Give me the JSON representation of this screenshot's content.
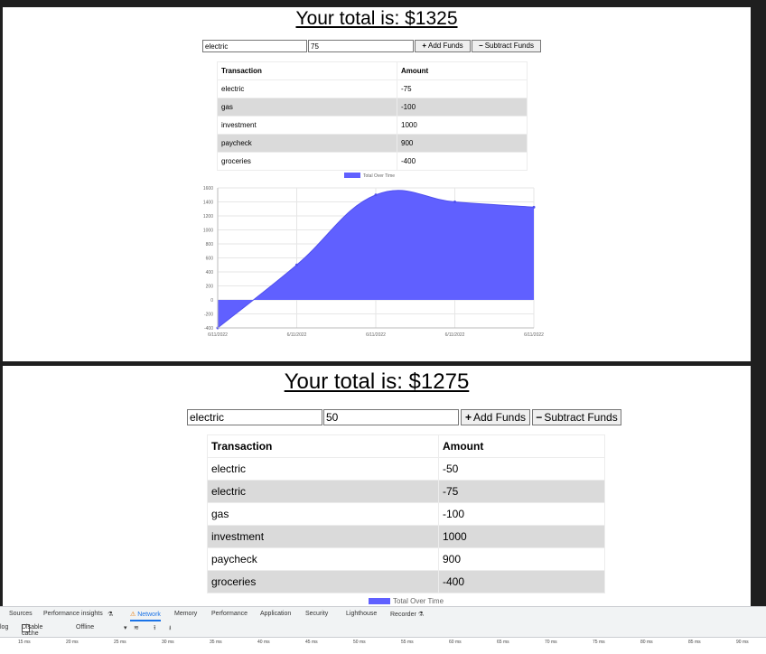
{
  "panel1": {
    "total_text": "Your total is: $1325",
    "name_value": "electric",
    "amount_value": "75",
    "add_label": "Add Funds",
    "subtract_label": "Subtract Funds",
    "table_headers": [
      "Transaction",
      "Amount"
    ],
    "rows": [
      [
        "electric",
        "-75"
      ],
      [
        "gas",
        "-100"
      ],
      [
        "investment",
        "1000"
      ],
      [
        "paycheck",
        "900"
      ],
      [
        "groceries",
        "-400"
      ]
    ],
    "chart_data": {
      "type": "area",
      "title": "",
      "legend": "Total Over Time",
      "legend_position": "top",
      "grid": true,
      "fill_color": "#6060ff",
      "x": [
        "6/11/2022",
        "6/11/2022",
        "6/11/2022",
        "6/11/2022",
        "6/11/2022"
      ],
      "values": [
        -400,
        500,
        1500,
        1400,
        1325
      ],
      "series": [
        {
          "name": "Total Over Time",
          "values": [
            -400,
            500,
            1500,
            1400,
            1325
          ]
        }
      ],
      "ylim": [
        -400,
        1600
      ],
      "yticks": [
        1600,
        1400,
        1200,
        1000,
        800,
        600,
        400,
        200,
        0,
        -200,
        -400
      ]
    }
  },
  "panel2": {
    "total_text": "Your total is: $1275",
    "name_value": "electric",
    "amount_value": "50",
    "add_label": "Add Funds",
    "subtract_label": "Subtract Funds",
    "table_headers": [
      "Transaction",
      "Amount"
    ],
    "rows": [
      [
        "electric",
        "-50"
      ],
      [
        "electric",
        "-75"
      ],
      [
        "gas",
        "-100"
      ],
      [
        "investment",
        "1000"
      ],
      [
        "paycheck",
        "900"
      ],
      [
        "groceries",
        "-400"
      ]
    ],
    "legend": "Total Over Time"
  },
  "devtools": {
    "tabs": [
      "Sources",
      "Performance insights",
      "Network",
      "Memory",
      "Performance",
      "Application",
      "Security",
      "Lighthouse",
      "Recorder"
    ],
    "active_tab": "Network",
    "log_label": "log",
    "disable_cache_label": "Disable cache",
    "throttle_label": "Offline",
    "ruler_ticks": [
      "15 ms",
      "20 ms",
      "25 ms",
      "30 ms",
      "35 ms",
      "40 ms",
      "45 ms",
      "50 ms",
      "55 ms",
      "60 ms",
      "65 ms",
      "70 ms",
      "75 ms",
      "80 ms",
      "85 ms",
      "90 ms"
    ]
  }
}
